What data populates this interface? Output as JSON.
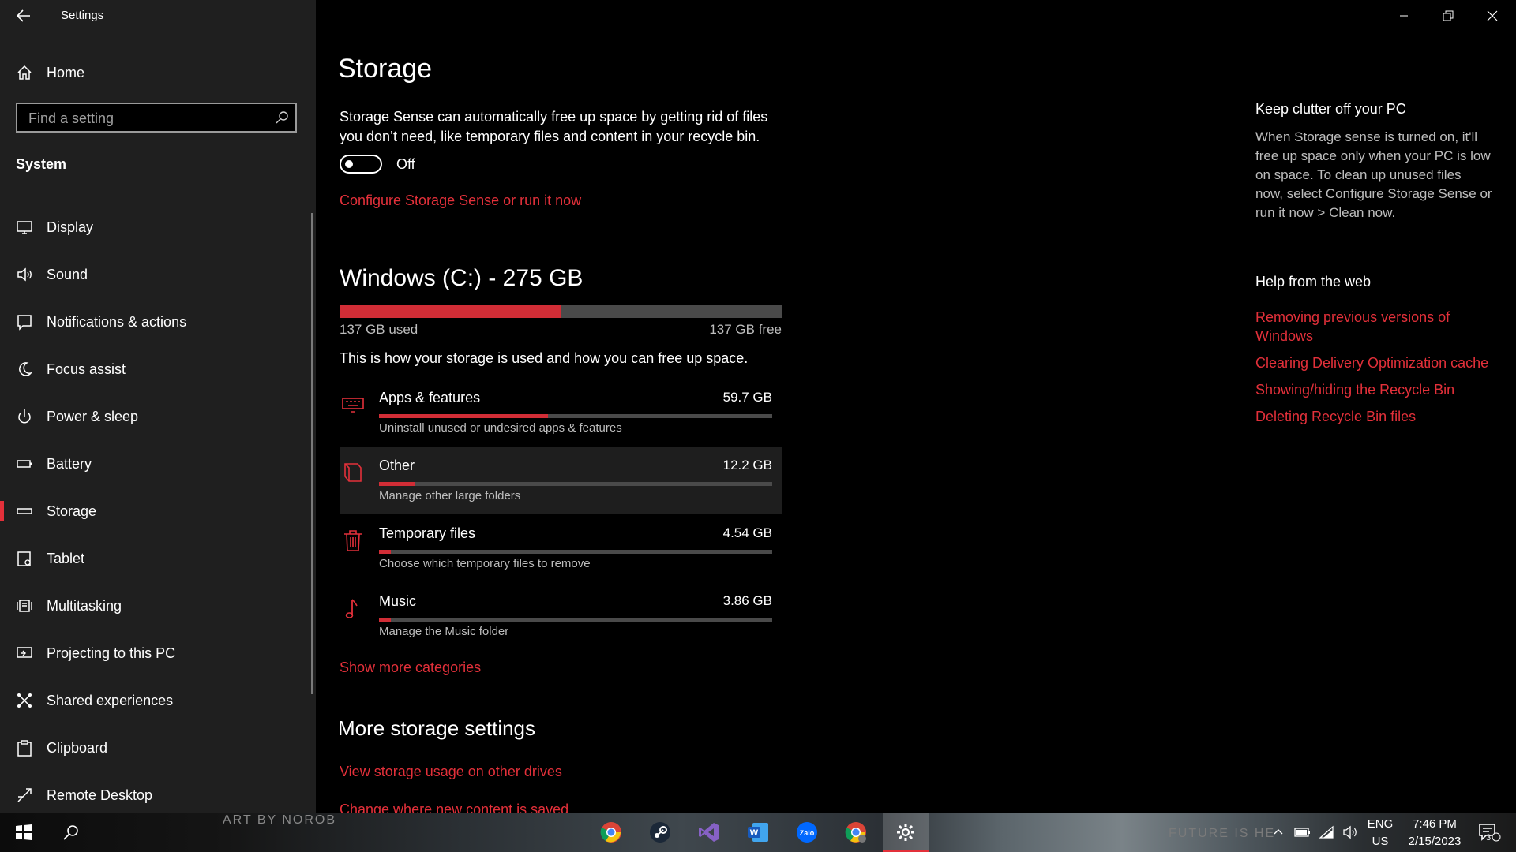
{
  "window": {
    "title": "Settings"
  },
  "sidebar": {
    "home_label": "Home",
    "search_placeholder": "Find a setting",
    "section": "System",
    "items": [
      {
        "label": "Display",
        "icon": "monitor-icon"
      },
      {
        "label": "Sound",
        "icon": "speaker-icon"
      },
      {
        "label": "Notifications & actions",
        "icon": "notification-icon"
      },
      {
        "label": "Focus assist",
        "icon": "moon-icon"
      },
      {
        "label": "Power & sleep",
        "icon": "power-icon"
      },
      {
        "label": "Battery",
        "icon": "battery-icon"
      },
      {
        "label": "Storage",
        "icon": "storage-icon",
        "active": true
      },
      {
        "label": "Tablet",
        "icon": "tablet-icon"
      },
      {
        "label": "Multitasking",
        "icon": "multitasking-icon"
      },
      {
        "label": "Projecting to this PC",
        "icon": "projector-icon"
      },
      {
        "label": "Shared experiences",
        "icon": "shared-icon"
      },
      {
        "label": "Clipboard",
        "icon": "clipboard-icon"
      },
      {
        "label": "Remote Desktop",
        "icon": "remote-desktop-icon"
      }
    ]
  },
  "main": {
    "title": "Storage",
    "description": "Storage Sense can automatically free up space by getting rid of files you don’t need, like temporary files and content in your recycle bin.",
    "toggle_state": "Off",
    "configure_link": "Configure Storage Sense or run it now",
    "drive": {
      "title": "Windows (C:) - 275 GB",
      "used_label": "137 GB used",
      "free_label": "137 GB free",
      "used_fraction": 0.5
    },
    "usage_description": "This is how your storage is used and how you can free up space.",
    "categories": [
      {
        "name": "Apps & features",
        "size": "59.7 GB",
        "sub": "Uninstall unused or undesired apps & features",
        "fraction": 0.43,
        "icon": "apps-icon"
      },
      {
        "name": "Other",
        "size": "12.2 GB",
        "sub": "Manage other large folders",
        "fraction": 0.09,
        "icon": "folder-icon"
      },
      {
        "name": "Temporary files",
        "size": "4.54 GB",
        "sub": "Choose which temporary files to remove",
        "fraction": 0.03,
        "icon": "trash-icon"
      },
      {
        "name": "Music",
        "size": "3.86 GB",
        "sub": "Manage the Music folder",
        "fraction": 0.03,
        "icon": "music-icon"
      }
    ],
    "show_more": "Show more categories",
    "more_settings_title": "More storage settings",
    "view_usage_link": "View storage usage on other drives",
    "change_location_link": "Change where new content is saved"
  },
  "right_panel": {
    "clutter_title": "Keep clutter off your PC",
    "clutter_text": "When Storage sense is turned on, it'll free up space only when your PC is low on space. To clean up unused files now, select Configure Storage Sense or run it now > Clean now.",
    "help_title": "Help from the web",
    "help_links": [
      "Removing previous versions of Windows",
      "Clearing Delivery Optimization cache",
      "Showing/hiding the Recycle Bin",
      "Deleting Recycle Bin files"
    ]
  },
  "taskbar": {
    "wallpaper_left": "ART BY NOROB",
    "wallpaper_right": "FUTURE IS HE",
    "lang_top": "ENG",
    "lang_bottom": "US",
    "time": "7:46 PM",
    "date": "2/15/2023",
    "notification_count": "3"
  },
  "colors": {
    "accent": "#e3303a",
    "sidebar_bg": "#1f1f1f",
    "main_bg": "#000000"
  }
}
